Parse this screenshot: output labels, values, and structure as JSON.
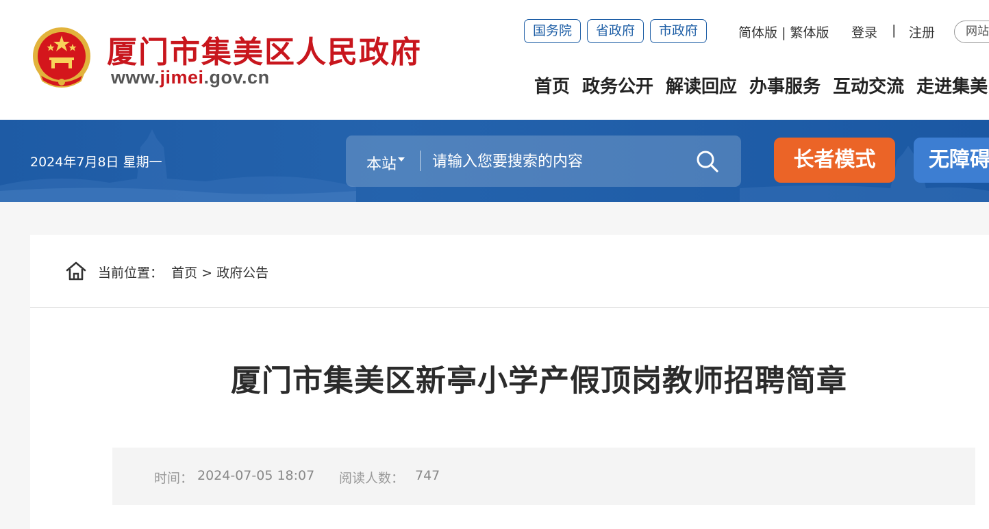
{
  "header": {
    "site_name": "厦门市集美区人民政府",
    "site_url_prefix": "www.",
    "site_url_accent": "jimei",
    "site_url_suffix": ".gov.cn",
    "gov_links": [
      {
        "label": "国务院"
      },
      {
        "label": "省政府"
      },
      {
        "label": "市政府"
      }
    ],
    "lang_simplified": "简体版",
    "lang_separator": "|",
    "lang_traditional": "繁体版",
    "login": "登录",
    "separator": "|",
    "register": "注册",
    "site_map": "网站",
    "nav": [
      {
        "label": "首页"
      },
      {
        "label": "政务公开"
      },
      {
        "label": "解读回应"
      },
      {
        "label": "办事服务"
      },
      {
        "label": "互动交流"
      },
      {
        "label": "走进集美"
      }
    ]
  },
  "band": {
    "date": "2024年7月8日 星期一",
    "search": {
      "scope": "本站",
      "placeholder": "请输入您要搜索的内容"
    },
    "elder_mode": "长者模式",
    "accessible_mode": "无障碍"
  },
  "breadcrumb": {
    "label": "当前位置：",
    "items": [
      {
        "label": "首页"
      },
      {
        "label": "政府公告"
      }
    ],
    "separator": ">"
  },
  "article": {
    "title": "厦门市集美区新亭小学产假顶岗教师招聘简章",
    "time_label": "时间：",
    "time": "2024-07-05 18:07",
    "reads_label": "阅读人数：",
    "reads": "747"
  },
  "colors": {
    "brand_red": "#c8161d",
    "link_blue": "#1f5fa6",
    "band_blue": "#1e5ba5",
    "elder_orange": "#eb6427",
    "accessible_blue": "#3d7ed2"
  }
}
